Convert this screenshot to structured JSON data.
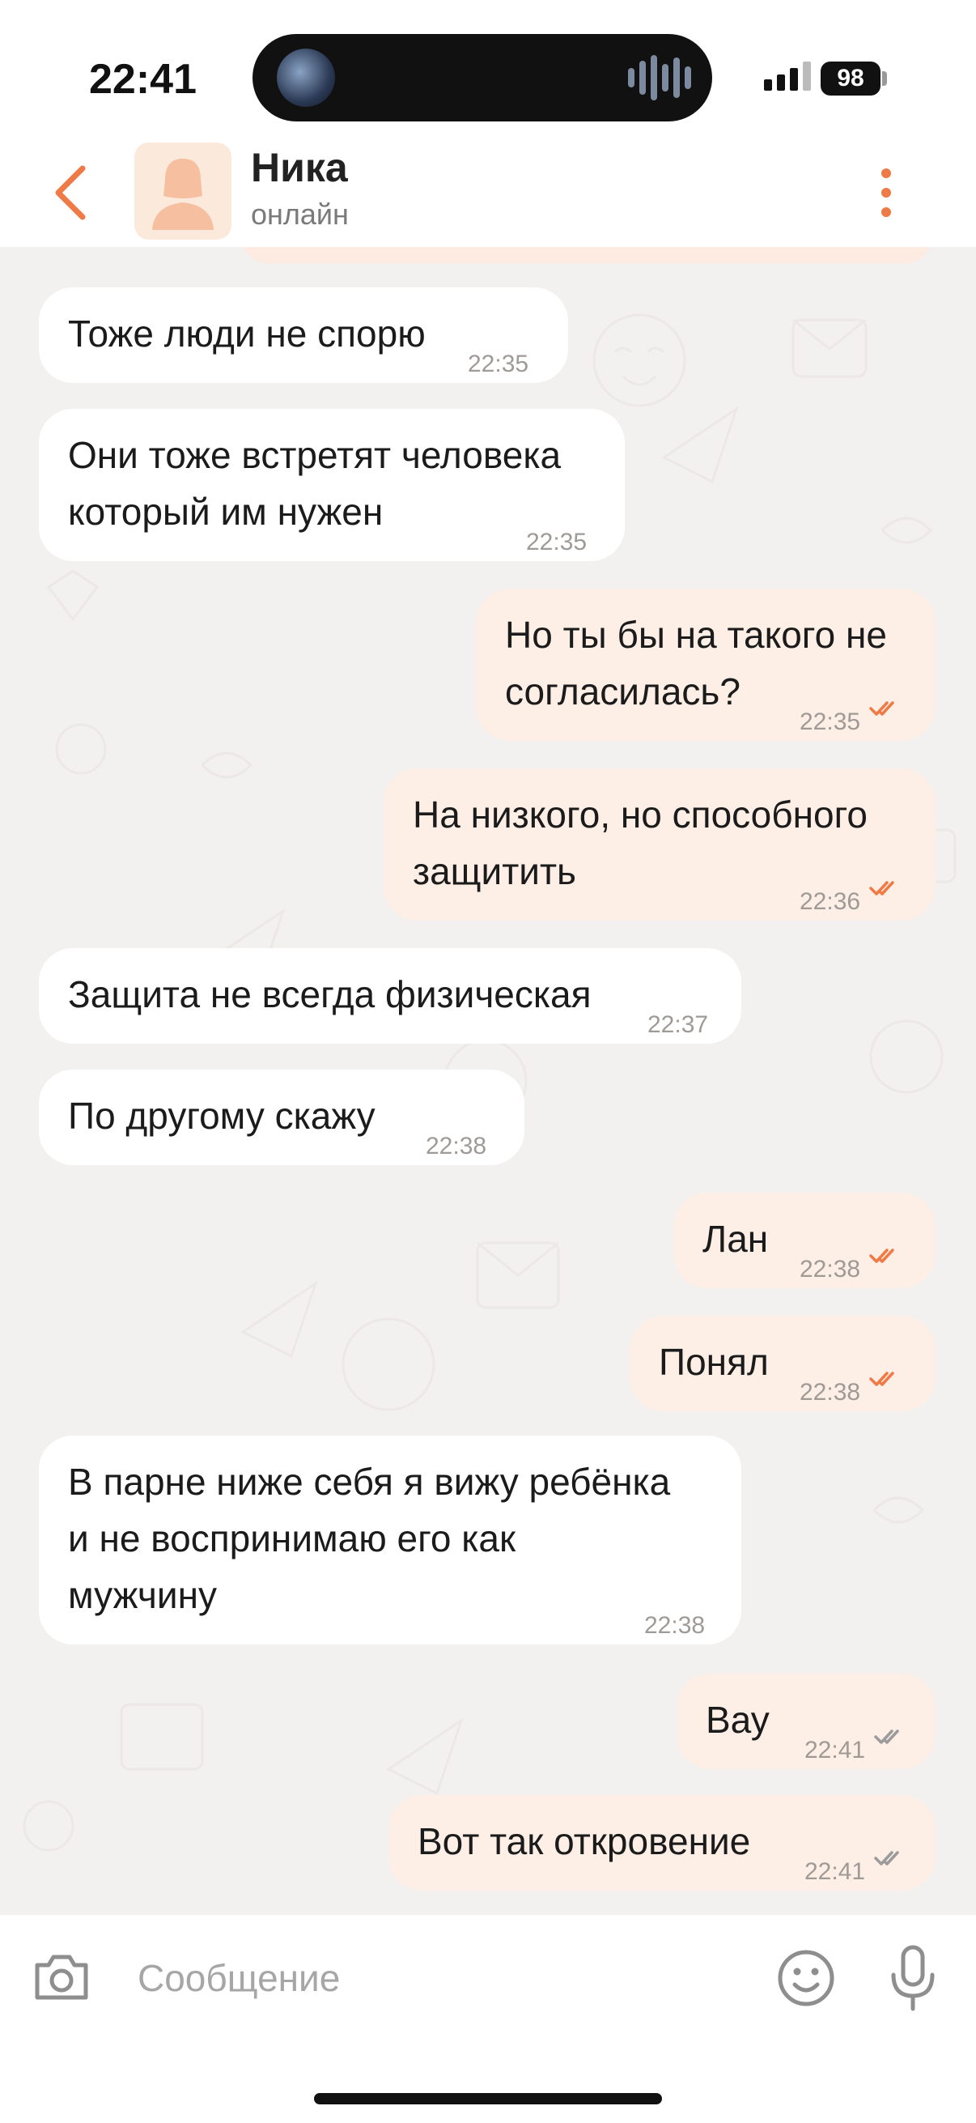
{
  "status_bar": {
    "time": "22:41",
    "battery": "98"
  },
  "header": {
    "back_icon": "chevron-left-icon",
    "name": "Ника",
    "status": "онлайн",
    "more_icon": "vertical-dots-icon",
    "accent": "#f07a45"
  },
  "messages": [
    {
      "dir": "in",
      "text": "Тоже люди не спорю",
      "time": "22:35"
    },
    {
      "dir": "in",
      "text": "Они тоже встретят человека\nкоторый им нужен",
      "time": "22:35"
    },
    {
      "dir": "out",
      "text": "Но ты бы на такого не\nсогласилась?",
      "time": "22:35",
      "status": "read"
    },
    {
      "dir": "out",
      "text": "На низкого, но способного\nзащитить",
      "time": "22:36",
      "status": "read"
    },
    {
      "dir": "in",
      "text": "Защита не всегда физическая",
      "time": "22:37"
    },
    {
      "dir": "in",
      "text": "По другому скажу",
      "time": "22:38"
    },
    {
      "dir": "out",
      "text": "Лан",
      "time": "22:38",
      "status": "read"
    },
    {
      "dir": "out",
      "text": "Понял",
      "time": "22:38",
      "status": "read"
    },
    {
      "dir": "in",
      "text": "В парне ниже себя я вижу ребёнка\nи не воспринимаю его как\nмужчину",
      "time": "22:38"
    },
    {
      "dir": "out",
      "text": "Вау",
      "time": "22:41",
      "status": "delivered"
    },
    {
      "dir": "out",
      "text": "Вот так откровение",
      "time": "22:41",
      "status": "delivered"
    }
  ],
  "colors": {
    "read_ticks": "#f07a45",
    "delivered_ticks": "#9b9b9b",
    "incoming_bg": "#ffffff",
    "outgoing_bg": "#fdeee6"
  },
  "input_bar": {
    "placeholder": "Сообщение",
    "camera_icon": "camera-icon",
    "emoji_icon": "smiley-icon",
    "mic_icon": "microphone-icon"
  }
}
